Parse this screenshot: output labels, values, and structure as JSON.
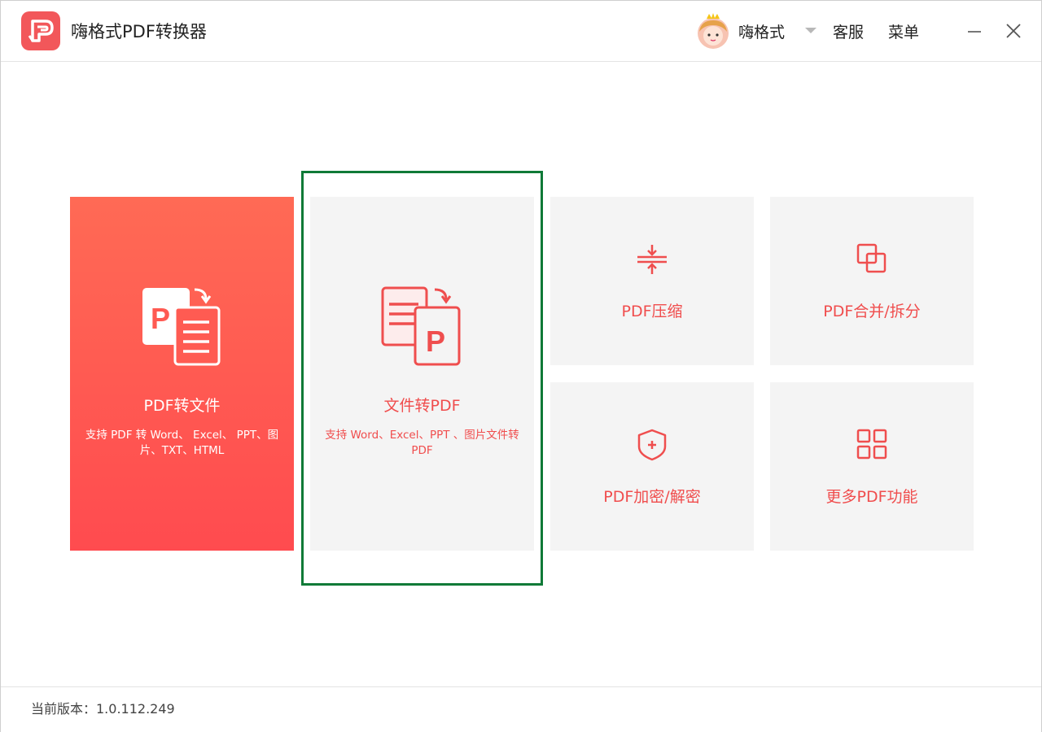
{
  "app": {
    "title": "嗨格式PDF转换器",
    "brand_color": "#f2575a"
  },
  "header": {
    "username": "嗨格式",
    "service_label": "客服",
    "menu_label": "菜单",
    "icons": [
      "app-logo",
      "avatar",
      "chevron-down-icon",
      "minimize-icon",
      "close-icon"
    ]
  },
  "features": {
    "pdf_to_file": {
      "title": "PDF转文件",
      "description": "支持 PDF 转 Word、 Excel、 PPT、图片、TXT、HTML",
      "icon": "pdf-to-document-icon"
    },
    "file_to_pdf": {
      "title": "文件转PDF",
      "description": "支持 Word、Excel、PPT 、图片文件转 PDF",
      "icon": "document-to-pdf-icon",
      "selected": true
    },
    "compress": {
      "title": "PDF压缩",
      "icon": "compress-icon"
    },
    "merge_split": {
      "title": "PDF合并/拆分",
      "icon": "merge-icon"
    },
    "encrypt": {
      "title": "PDF加密/解密",
      "icon": "shield-icon"
    },
    "more": {
      "title": "更多PDF功能",
      "icon": "grid-icon"
    }
  },
  "footer": {
    "version": "当前版本：1.0.112.249"
  },
  "colors": {
    "accent_red": "#f04d4d",
    "selection_green": "#0f7a37",
    "card_bg": "#f4f4f4"
  }
}
